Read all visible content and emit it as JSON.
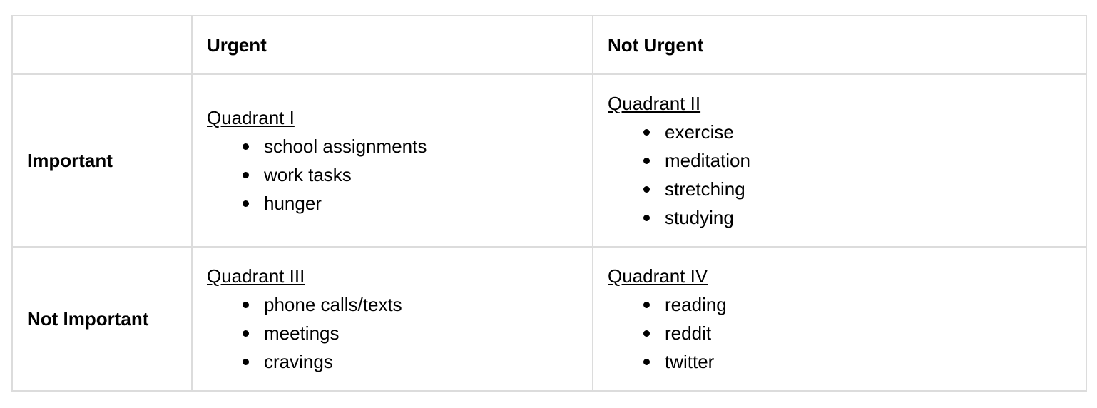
{
  "header": {
    "corner": "",
    "urgent": "Urgent",
    "not_urgent": "Not Urgent"
  },
  "rows": [
    {
      "label": "Important",
      "urgent": {
        "title": "Quadrant I",
        "items": [
          "school assignments",
          "work tasks",
          "hunger"
        ]
      },
      "not_urgent": {
        "title": "Quadrant II",
        "items": [
          "exercise",
          "meditation",
          "stretching",
          "studying"
        ]
      }
    },
    {
      "label": "Not Important",
      "urgent": {
        "title": "Quadrant III",
        "items": [
          "phone calls/texts",
          "meetings",
          "cravings"
        ]
      },
      "not_urgent": {
        "title": "Quadrant IV",
        "items": [
          "reading",
          "reddit",
          "twitter"
        ]
      }
    }
  ]
}
